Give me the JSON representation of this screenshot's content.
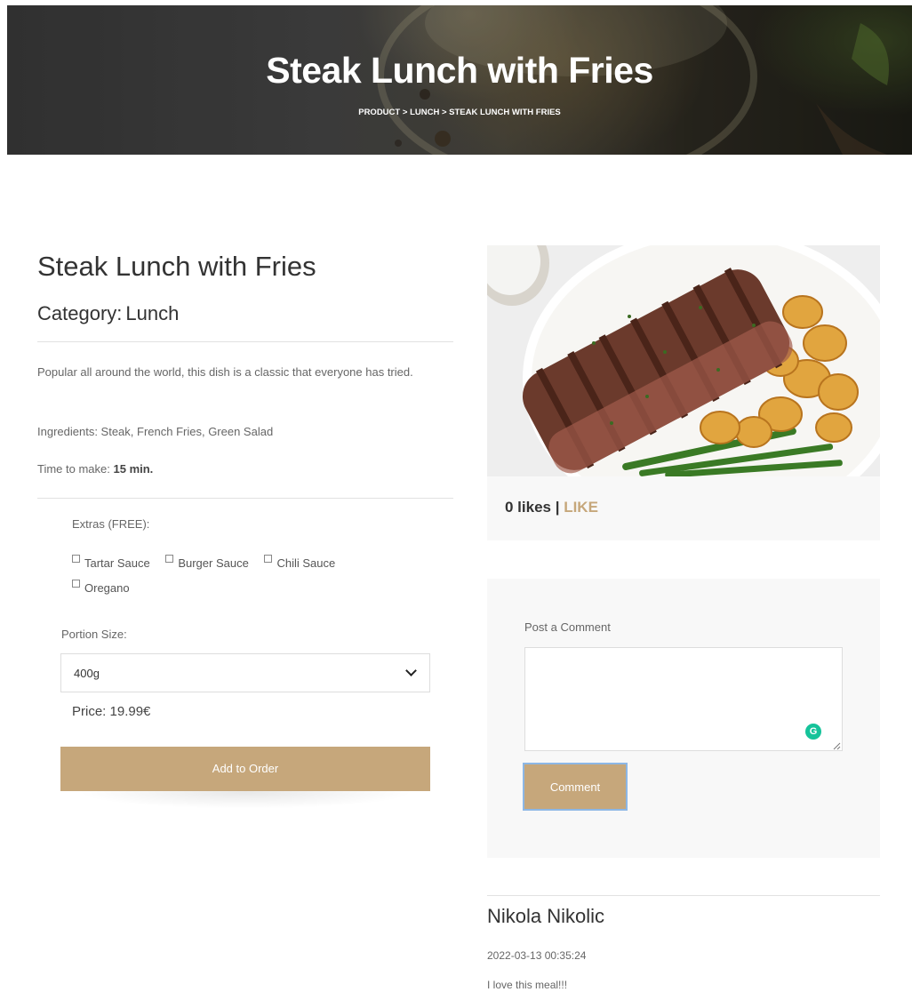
{
  "hero": {
    "title": "Steak Lunch with Fries",
    "breadcrumb": [
      "PRODUCT",
      "LUNCH",
      "STEAK LUNCH WITH FRIES"
    ],
    "separator": ">"
  },
  "product": {
    "title": "Steak Lunch with Fries",
    "category_label": "Category:",
    "category_value": "Lunch",
    "description": "Popular all around the world, this dish is a classic that everyone has tried.",
    "ingredients": "Ingredients: Steak, French Fries, Green Salad",
    "time_label": "Time to make:",
    "time_value": "15 min."
  },
  "order": {
    "extras_label": "Extras (FREE):",
    "extras": [
      {
        "label": "Tartar Sauce",
        "checked": false
      },
      {
        "label": "Burger Sauce",
        "checked": false
      },
      {
        "label": "Chili Sauce",
        "checked": false
      },
      {
        "label": "Oregano",
        "checked": false
      }
    ],
    "portion_label": "Portion Size:",
    "portion_selected": "400g",
    "price_text": "Price: 19.99€",
    "add_button": "Add to Order"
  },
  "likes": {
    "count_text": "0 likes |",
    "like_link": "LIKE"
  },
  "comment_form": {
    "label": "Post a Comment",
    "textarea_value": "",
    "grammarly_icon": "G",
    "submit_button": "Comment"
  },
  "comments": [
    {
      "author": "Nikola Nikolic",
      "date": "2022-03-13 00:35:24",
      "text": "I love this meal!!!"
    }
  ],
  "colors": {
    "accent": "#c6a77b",
    "panel_bg": "#f8f8f8",
    "grammarly": "#15c39a",
    "focus_ring": "#8db7e5"
  }
}
